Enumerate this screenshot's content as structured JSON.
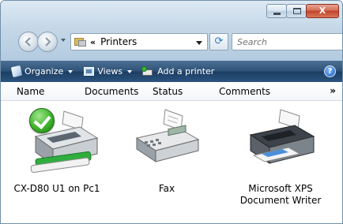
{
  "window": {
    "caption_buttons": {
      "minimize": "",
      "maximize": "",
      "close": "X"
    }
  },
  "address_bar": {
    "chevron": "«",
    "path": "Printers"
  },
  "search": {
    "placeholder": "Search"
  },
  "toolbar": {
    "organize": "Organize",
    "views": "Views",
    "add_printer": "Add a printer",
    "help": "?"
  },
  "columns": {
    "name": "Name",
    "documents": "Documents",
    "status": "Status",
    "comments": "Comments",
    "more": "»"
  },
  "printers": [
    {
      "label": "CX-D80 U1 on Pc1",
      "icon": "printer-network-default-icon",
      "is_default": true
    },
    {
      "label": "Fax",
      "icon": "fax-icon",
      "is_default": false
    },
    {
      "label_line1": "Microsoft XPS",
      "label_line2": "Document Writer",
      "icon": "printer-icon",
      "is_default": false
    }
  ]
}
